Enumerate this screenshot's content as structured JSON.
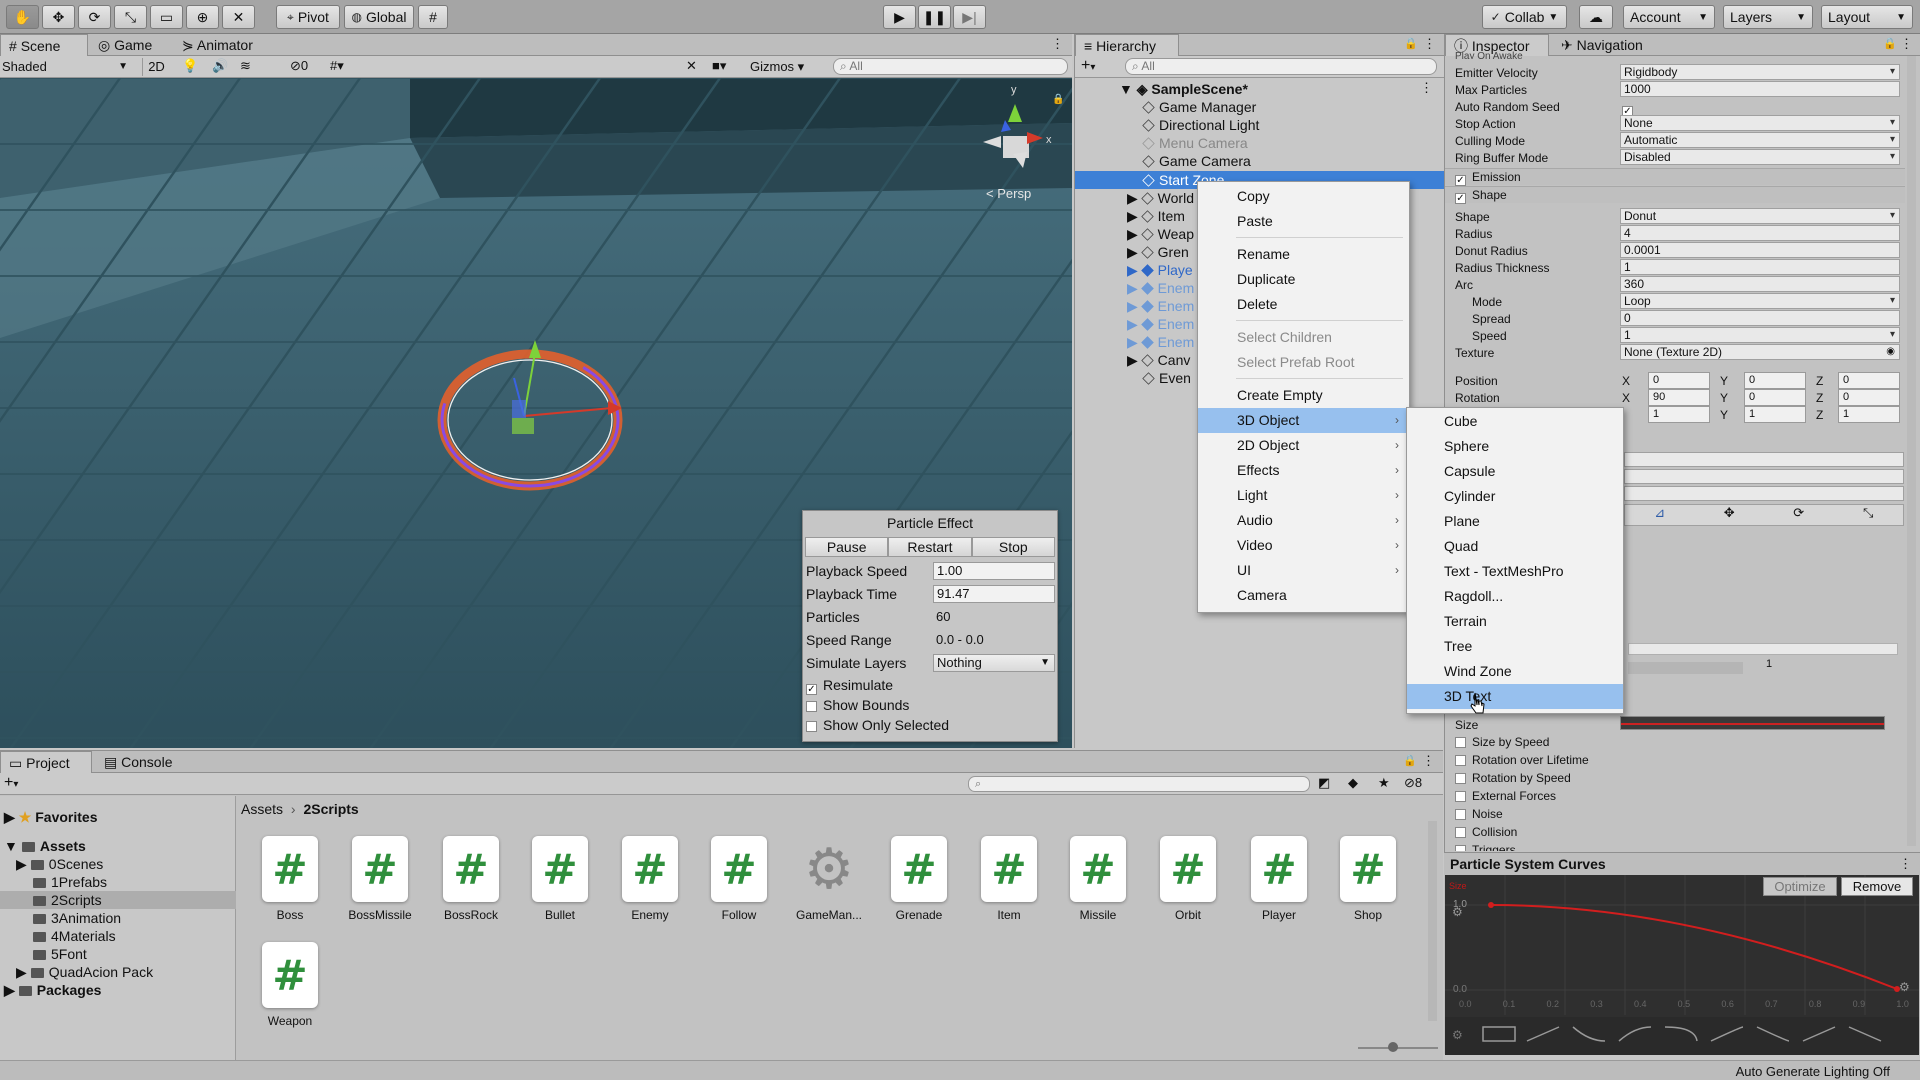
{
  "toolbar": {
    "pivot": "Pivot",
    "global": "Global",
    "collab": "Collab",
    "account": "Account",
    "layers": "Layers",
    "layout": "Layout"
  },
  "scene_panel": {
    "tabs": [
      "Scene",
      "Game",
      "Animator"
    ],
    "shading": "Shaded",
    "mode_2d": "2D",
    "hidden_count": "0",
    "gizmos": "Gizmos",
    "search_placeholder": "All",
    "persp_label": "Persp",
    "gizmo_y": "y",
    "gizmo_x": "x"
  },
  "particle_effect": {
    "title": "Particle Effect",
    "buttons": [
      "Pause",
      "Restart",
      "Stop"
    ],
    "rows": [
      {
        "label": "Playback Speed",
        "value": "1.00"
      },
      {
        "label": "Playback Time",
        "value": "91.47"
      },
      {
        "label": "Particles",
        "value": "60"
      },
      {
        "label": "Speed Range",
        "value": "0.0 - 0.0"
      },
      {
        "label": "Simulate Layers",
        "value": "Nothing"
      }
    ],
    "checks": [
      {
        "label": "Resimulate",
        "checked": true
      },
      {
        "label": "Show Bounds",
        "checked": false
      },
      {
        "label": "Show Only Selected",
        "checked": false
      }
    ]
  },
  "hierarchy": {
    "tab": "Hierarchy",
    "search_placeholder": "All",
    "scene": "SampleScene*",
    "items": [
      "Game Manager",
      "Directional Light",
      "Menu Camera",
      "Game Camera",
      "Start Zone",
      "World",
      "Item",
      "Weap",
      "Gren",
      "Playe",
      "Enem",
      "Enem",
      "Enem",
      "Enem",
      "Canv",
      "Even"
    ]
  },
  "context_menu": {
    "items": [
      "Copy",
      "Paste",
      "Rename",
      "Duplicate",
      "Delete",
      "Select Children",
      "Select Prefab Root",
      "Create Empty",
      "3D Object",
      "2D Object",
      "Effects",
      "Light",
      "Audio",
      "Video",
      "UI",
      "Camera"
    ]
  },
  "submenu": {
    "items": [
      "Cube",
      "Sphere",
      "Capsule",
      "Cylinder",
      "Plane",
      "Quad",
      "Text - TextMeshPro",
      "Ragdoll...",
      "Terrain",
      "Tree",
      "Wind Zone",
      "3D Text"
    ]
  },
  "inspector": {
    "tabs": [
      "Inspector",
      "Navigation"
    ],
    "top_cut": "Play On Awake",
    "main": [
      {
        "label": "Emitter Velocity",
        "value": "Rigidbody"
      },
      {
        "label": "Max Particles",
        "value": "1000"
      },
      {
        "label": "Auto Random Seed",
        "value": ""
      },
      {
        "label": "Stop Action",
        "value": "None"
      },
      {
        "label": "Culling Mode",
        "value": "Automatic"
      },
      {
        "label": "Ring Buffer Mode",
        "value": "Disabled"
      }
    ],
    "emission": "Emission",
    "shape_header": "Shape",
    "shape": [
      {
        "label": "Shape",
        "value": "Donut"
      },
      {
        "label": "Radius",
        "value": "4"
      },
      {
        "label": "Donut Radius",
        "value": "0.0001"
      },
      {
        "label": "Radius Thickness",
        "value": "1"
      },
      {
        "label": "Arc",
        "value": "360"
      },
      {
        "label": "Mode",
        "value": "Loop"
      },
      {
        "label": "Spread",
        "value": "0"
      },
      {
        "label": "Speed",
        "value": "1"
      },
      {
        "label": "Texture",
        "value": "None (Texture 2D)"
      }
    ],
    "position": {
      "label": "Position",
      "x": "0",
      "y": "0",
      "z": "0"
    },
    "rotation": {
      "label": "Rotation",
      "x": "90",
      "y": "0",
      "z": "0"
    },
    "scale": {
      "x": "1",
      "y": "1",
      "z": "1"
    },
    "size_label": "Size",
    "size_val": "1",
    "modules": [
      "Size by Speed",
      "Rotation over Lifetime",
      "Rotation by Speed",
      "External Forces",
      "Noise",
      "Collision",
      "Triggers"
    ],
    "xyz": [
      "X",
      "Y",
      "Z"
    ]
  },
  "curves": {
    "title": "Particle System Curves",
    "optimize": "Optimize",
    "remove": "Remove",
    "size_tag": "Size",
    "y_top": "1.0",
    "y_bottom": "0.0",
    "x_ticks": [
      "0.0",
      "0.1",
      "0.2",
      "0.3",
      "0.4",
      "0.5",
      "0.6",
      "0.7",
      "0.8",
      "0.9",
      "1.0"
    ]
  },
  "project": {
    "tabs": [
      "Project",
      "Console"
    ],
    "favorites": "Favorites",
    "assets_root": "Assets",
    "folders": [
      "0Scenes",
      "1Prefabs",
      "2Scripts",
      "3Animation",
      "4Materials",
      "5Font",
      "QuadAcion Pack"
    ],
    "packages": "Packages",
    "breadcrumb": [
      "Assets",
      "2Scripts"
    ],
    "hidden_count": "8",
    "assets": [
      "Boss",
      "BossMissile",
      "BossRock",
      "Bullet",
      "Enemy",
      "Follow",
      "GameMan...",
      "Grenade",
      "Item",
      "Missile",
      "Orbit",
      "Player",
      "Shop",
      "Weapon"
    ]
  },
  "status": {
    "text": "Auto Generate Lighting Off"
  }
}
